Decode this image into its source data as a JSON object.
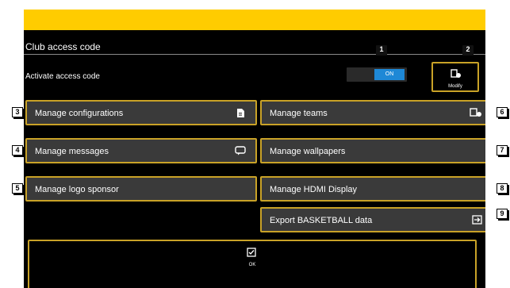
{
  "header": {
    "title": "Club access code",
    "activate_label": "Activate access code",
    "toggle_state": "ON",
    "modify_label": "Modify"
  },
  "buttons": {
    "manage_configurations": "Manage configurations",
    "manage_teams": "Manage teams",
    "manage_messages": "Manage messages",
    "manage_wallpapers": "Manage wallpapers",
    "manage_logo_sponsor": "Manage logo sponsor",
    "manage_hdmi_display": "Manage HDMI Display",
    "export_basketball_data": "Export BASKETBALL data"
  },
  "footer": {
    "ok_label": "OK"
  },
  "callouts": [
    "1",
    "2",
    "3",
    "4",
    "5",
    "6",
    "7",
    "8",
    "9"
  ],
  "colors": {
    "accent_yellow": "#ffcc00",
    "button_border": "#c9a227",
    "button_fill": "#3a3a3a",
    "toggle_on": "#1e88d6",
    "background": "#000000"
  },
  "icons": {
    "modify": "people-edit-icon",
    "configurations": "document-edit-icon",
    "teams": "people-icon",
    "messages": "chat-bubble-icon",
    "export": "export-arrow-icon",
    "ok": "checkbox-icon"
  }
}
